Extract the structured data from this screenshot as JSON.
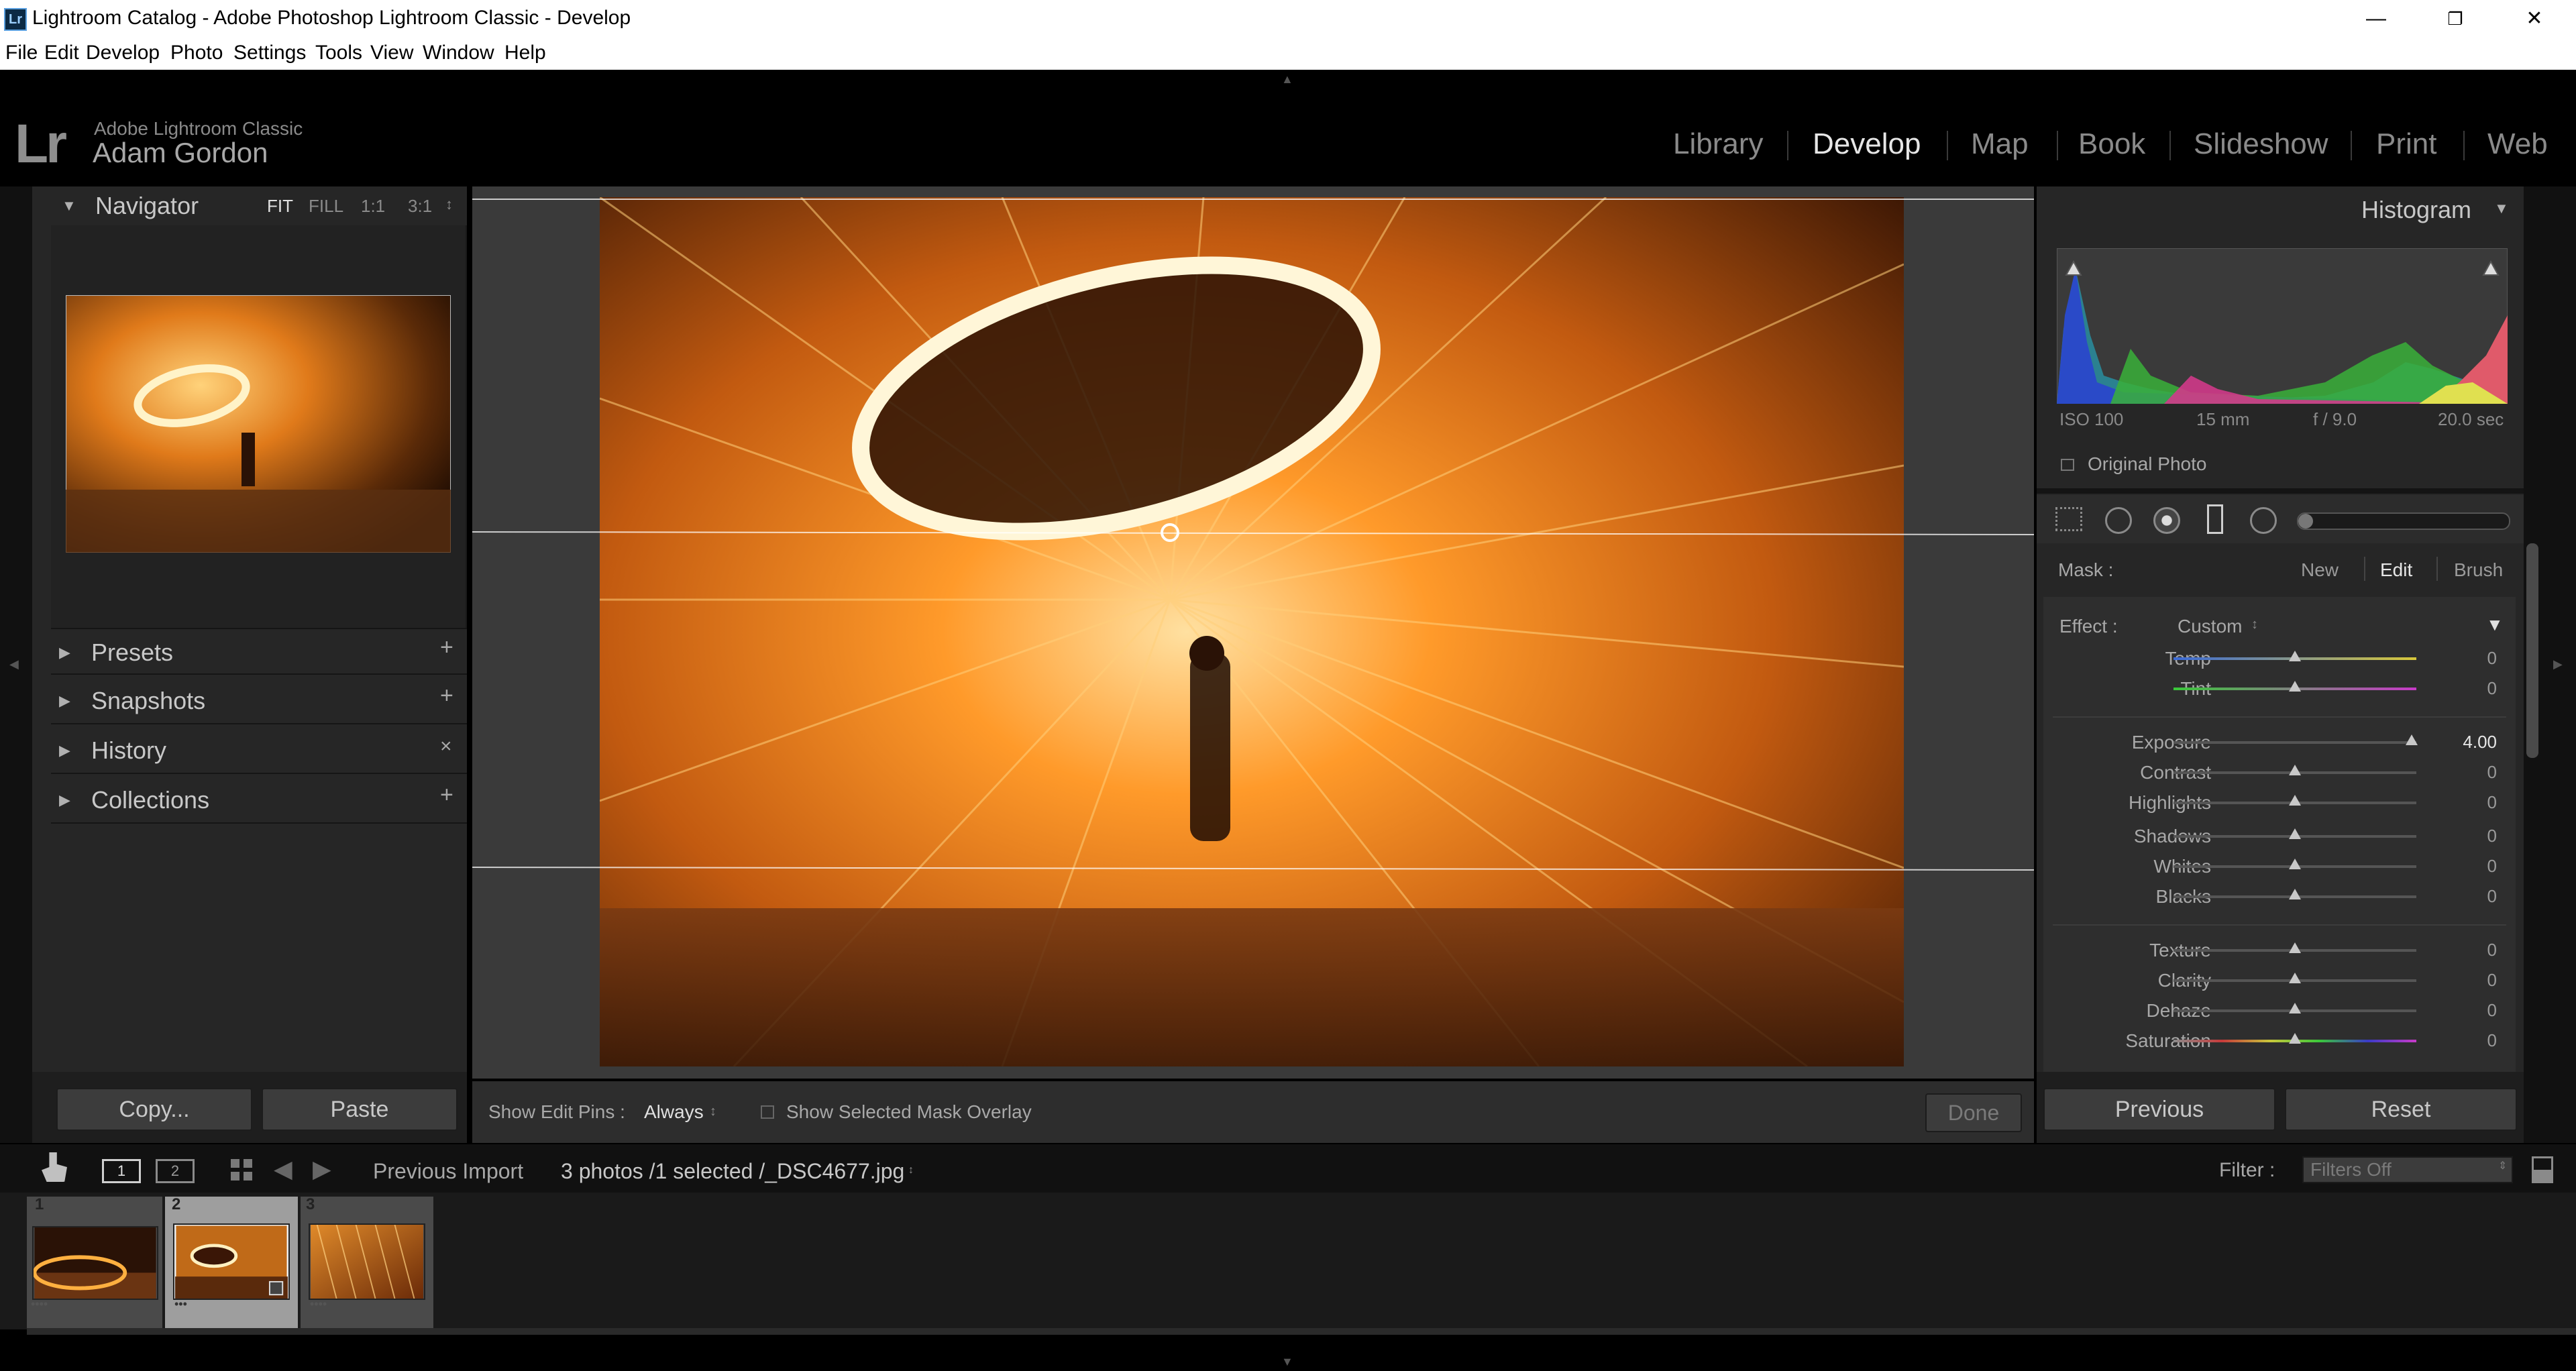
{
  "window": {
    "title": "Lightroom Catalog - Adobe Photoshop Lightroom Classic - Develop",
    "app_icon": "Lr",
    "minimize": "—",
    "restore": "❐",
    "close": "✕"
  },
  "menu": [
    "File",
    "Edit",
    "Develop",
    "Photo",
    "Settings",
    "Tools",
    "View",
    "Window",
    "Help"
  ],
  "identity": {
    "logo": "Lr",
    "app_name": "Adobe Lightroom Classic",
    "user_name": "Adam Gordon"
  },
  "modules": [
    "Library",
    "Develop",
    "Map",
    "Book",
    "Slideshow",
    "Print",
    "Web"
  ],
  "active_module": "Develop",
  "left_panel": {
    "navigator": {
      "title": "Navigator",
      "zoom_options": [
        "FIT",
        "FILL",
        "1:1",
        "3:1"
      ],
      "stepper": "↕"
    },
    "sections": [
      {
        "title": "Presets",
        "action": "+"
      },
      {
        "title": "Snapshots",
        "action": "+"
      },
      {
        "title": "History",
        "action": "×"
      },
      {
        "title": "Collections",
        "action": "+"
      }
    ],
    "copy_button": "Copy...",
    "paste_button": "Paste"
  },
  "toolbar": {
    "show_edit_pins_label": "Show Edit Pins :",
    "show_edit_pins_value": "Always",
    "show_edit_pins_arrow": "↕",
    "mask_overlay_label": "Show Selected Mask Overlay",
    "done_button": "Done"
  },
  "right_panel": {
    "histogram": {
      "title": "Histogram",
      "iso": "ISO 100",
      "focal": "15 mm",
      "aperture": "f / 9.0",
      "shutter": "20.0 sec",
      "original_photo_label": "Original Photo"
    },
    "mask": {
      "label": "Mask :",
      "modes": [
        "New",
        "Edit",
        "Brush"
      ],
      "active_mode": "Edit"
    },
    "effect": {
      "label": "Effect :",
      "value": "Custom",
      "arrow": "↕"
    },
    "sliders": [
      {
        "label": "Temp",
        "value": "0",
        "position": 0.5
      },
      {
        "label": "Tint",
        "value": "0",
        "position": 0.5
      },
      {
        "label": "Exposure",
        "value": "4.00",
        "position": 0.98
      },
      {
        "label": "Contrast",
        "value": "0",
        "position": 0.5
      },
      {
        "label": "Highlights",
        "value": "0",
        "position": 0.5
      },
      {
        "label": "Shadows",
        "value": "0",
        "position": 0.5
      },
      {
        "label": "Whites",
        "value": "0",
        "position": 0.5
      },
      {
        "label": "Blacks",
        "value": "0",
        "position": 0.5
      },
      {
        "label": "Texture",
        "value": "0",
        "position": 0.5
      },
      {
        "label": "Clarity",
        "value": "0",
        "position": 0.5
      },
      {
        "label": "Dehaze",
        "value": "0",
        "position": 0.5
      },
      {
        "label": "Saturation",
        "value": "0",
        "position": 0.5
      }
    ],
    "previous_button": "Previous",
    "reset_button": "Reset"
  },
  "filmstrip_bar": {
    "view1": "1",
    "view2": "2",
    "source": "Previous Import",
    "info": "3 photos /1 selected /_DSC4677.jpg",
    "info_arrow": "↕",
    "filter_label": "Filter :",
    "filter_value": "Filters Off"
  },
  "filmstrip": [
    {
      "number": "1",
      "dots": "••••",
      "selected": false
    },
    {
      "number": "2",
      "dots": "•••",
      "selected": true
    },
    {
      "number": "3",
      "dots": "••••",
      "selected": false
    }
  ],
  "colors": {
    "background": "#000000",
    "panel": "#262626",
    "accent": "#e6e6e6",
    "photo_orange": "#ff9a2a"
  }
}
